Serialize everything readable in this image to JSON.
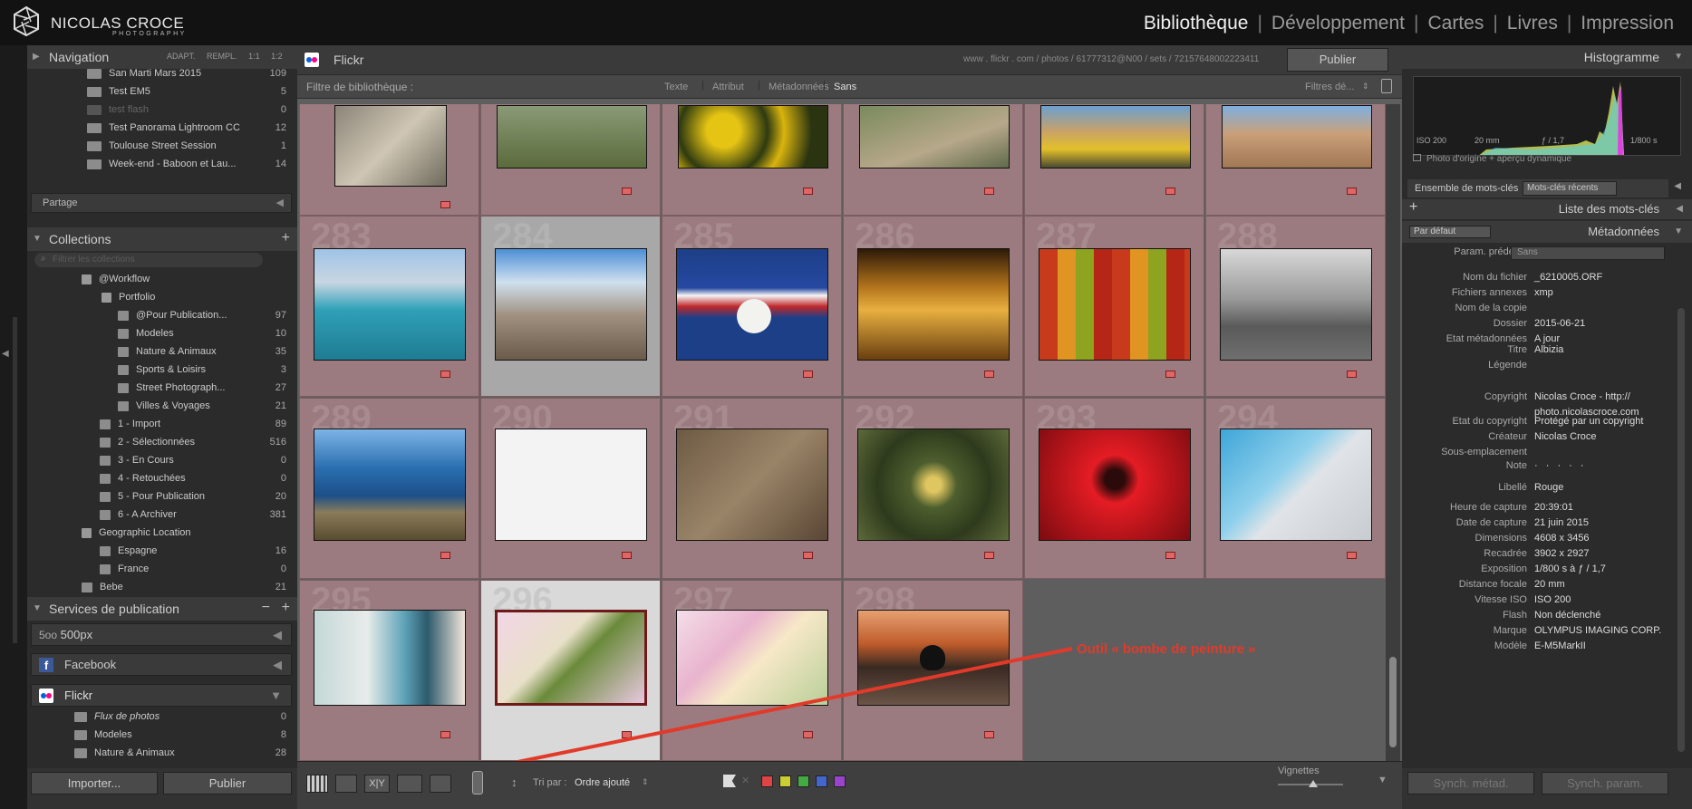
{
  "brand": {
    "name": "NICOLAS CROCE",
    "sub": "PHOTOGRAPHY"
  },
  "modules": [
    "Bibliothèque",
    "Développement",
    "Cartes",
    "Livres",
    "Impression"
  ],
  "left": {
    "nav_title": "Navigation",
    "nav_modes": [
      "ADAPT.",
      "REMPL.",
      "1:1",
      "1:2"
    ],
    "folders": [
      {
        "label": "San Marti Mars 2015",
        "count": "109"
      },
      {
        "label": "Test EM5",
        "count": "5"
      },
      {
        "label": "test flash",
        "count": "0"
      },
      {
        "label": "Test Panorama Lightroom CC",
        "count": "12"
      },
      {
        "label": "Toulouse Street Session",
        "count": "1"
      },
      {
        "label": "Week-end - Baboon et Lau...",
        "count": "14"
      }
    ],
    "partage": "Partage",
    "collections_title": "Collections",
    "filter_placeholder": "Filtrer les collections",
    "collections": [
      {
        "label": "@Workflow",
        "count": ""
      },
      {
        "label": "Portfolio",
        "count": ""
      },
      {
        "label": "@Pour Publication...",
        "count": "97"
      },
      {
        "label": "Modeles",
        "count": "10"
      },
      {
        "label": "Nature & Animaux",
        "count": "35"
      },
      {
        "label": "Sports & Loisirs",
        "count": "3"
      },
      {
        "label": "Street Photograph...",
        "count": "27"
      },
      {
        "label": "Villes & Voyages",
        "count": "21"
      },
      {
        "label": "1 - Import",
        "count": "89"
      },
      {
        "label": "2 - Sélectionnées",
        "count": "516"
      },
      {
        "label": "3 - En Cours",
        "count": "0"
      },
      {
        "label": "4 - Retouchées",
        "count": "0"
      },
      {
        "label": "5 - Pour Publication",
        "count": "20"
      },
      {
        "label": "6 - A Archiver",
        "count": "381"
      },
      {
        "label": "Geographic Location",
        "count": ""
      },
      {
        "label": "Espagne",
        "count": "16"
      },
      {
        "label": "France",
        "count": "0"
      },
      {
        "label": "Bebe",
        "count": "21"
      }
    ],
    "services_title": "Services de publication",
    "services": [
      "500px",
      "Facebook",
      "Flickr"
    ],
    "flickr_items": [
      {
        "label": "Flux de photos",
        "count": "0"
      },
      {
        "label": "Modeles",
        "count": "8"
      },
      {
        "label": "Nature & Animaux",
        "count": "28"
      }
    ],
    "import_btn": "Importer...",
    "publish_btn": "Publier"
  },
  "center": {
    "service": "Flickr",
    "url": "www . flickr . com / photos / 61777312@N00 / sets / 72157648002223411",
    "publish": "Publier",
    "filter_label": "Filtre de bibliothèque :",
    "filter_tabs": [
      "Texte",
      "Attribut",
      "Métadonnées",
      "Sans"
    ],
    "filter_preset": "Filtres dé...",
    "cell_numbers": [
      "283",
      "284",
      "285",
      "286",
      "287",
      "288",
      "289",
      "290",
      "291",
      "292",
      "293",
      "294",
      "295",
      "296",
      "297",
      "298"
    ],
    "annotation": "Outil « bombe de peinture »",
    "sort_label": "Tri par :",
    "sort_value": "Ordre ajouté",
    "thumbs_label": "Vignettes",
    "xy": "X|Y"
  },
  "right": {
    "histogram_title": "Histogramme",
    "hist_info": [
      "ISO 200",
      "20 mm",
      "ƒ / 1,7",
      "1/800 s"
    ],
    "preview_note": "Photo d'origine + aperçu dynamique",
    "keyword_set_label": "Ensemble de mots-clés",
    "keyword_set_value": "Mots-clés récents",
    "keyword_list": "Liste des mots-clés",
    "meta_preset": "Par défaut",
    "meta_title": "Métadonnées",
    "param_label": "Param. prédéf.",
    "param_value": "Sans",
    "fields": [
      {
        "k": "Nom du fichier",
        "v": "_6210005.ORF"
      },
      {
        "k": "Fichiers annexes",
        "v": "xmp"
      },
      {
        "k": "Nom de la copie",
        "v": ""
      },
      {
        "k": "Dossier",
        "v": "2015-06-21"
      },
      {
        "k": "Etat métadonnées",
        "v": "A jour"
      }
    ],
    "fields2": [
      {
        "k": "Titre",
        "v": "Albizia"
      },
      {
        "k": "Légende",
        "v": ""
      }
    ],
    "copyright_label": "Copyright",
    "copyright_value": "Nicolas Croce - http://",
    "copyright_value2": "photo.nicolascroce.com",
    "fields3": [
      {
        "k": "Etat du copyright",
        "v": "Protégé par un copyright"
      },
      {
        "k": "Créateur",
        "v": "Nicolas Croce"
      },
      {
        "k": "Sous-emplacement",
        "v": ""
      }
    ],
    "note_label": "Note",
    "note_value": "· · · · ·",
    "label_label": "Libellé",
    "label_value": "Rouge",
    "fields4": [
      {
        "k": "Heure de capture",
        "v": "20:39:01"
      },
      {
        "k": "Date de capture",
        "v": "21 juin 2015"
      }
    ],
    "fields5": [
      {
        "k": "Dimensions",
        "v": "4608 x 3456"
      },
      {
        "k": "Recadrée",
        "v": "3902 x 2927"
      },
      {
        "k": "Exposition",
        "v": "1/800 s à ƒ / 1,7"
      },
      {
        "k": "Distance focale",
        "v": "20 mm"
      },
      {
        "k": "Vitesse ISO",
        "v": "ISO 200"
      },
      {
        "k": "Flash",
        "v": "Non déclenché"
      },
      {
        "k": "Marque",
        "v": "OLYMPUS IMAGING CORP."
      },
      {
        "k": "Modèle",
        "v": "E-M5MarkII"
      }
    ],
    "sync_meta": "Synch. métad.",
    "sync_param": "Synch. param."
  },
  "colors": {
    "accent_red": "#e23a2a",
    "label_red": "#e06666",
    "selected": "#a8a8a8"
  }
}
